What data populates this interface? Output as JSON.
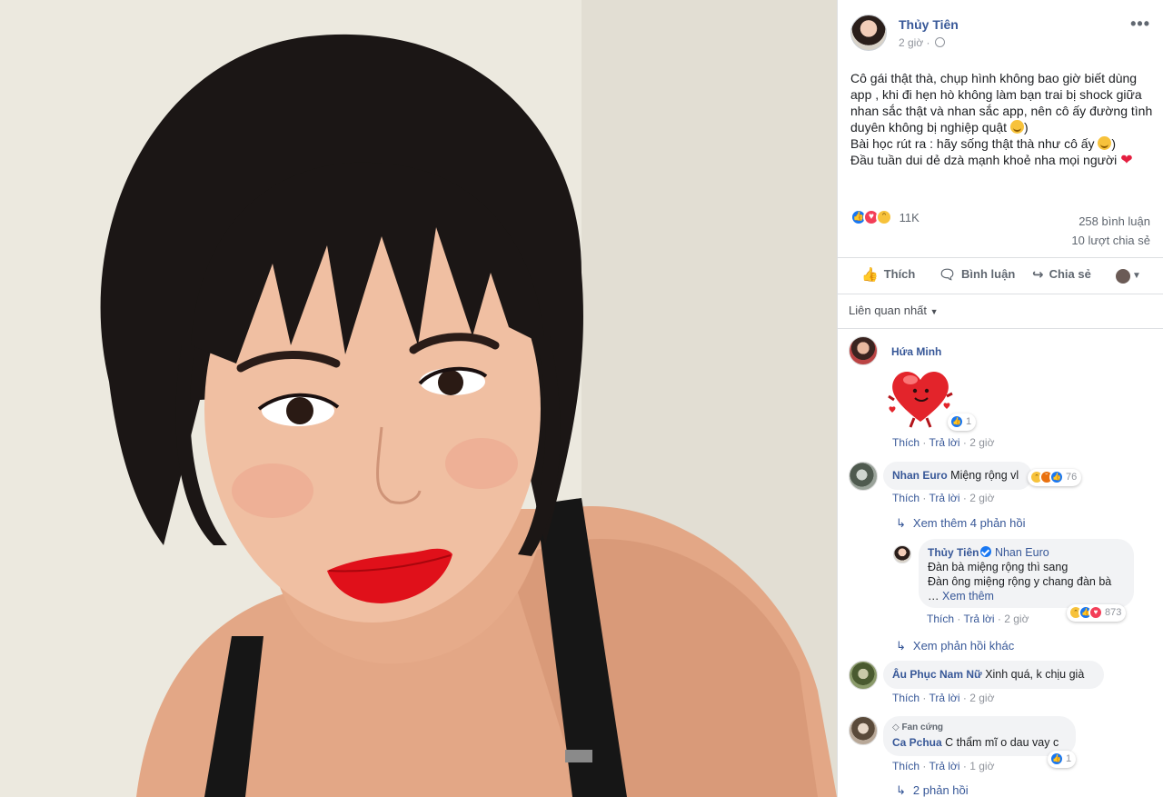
{
  "post": {
    "author": "Thủy Tiên",
    "time": "2 giờ",
    "privacy_icon": "globe-icon",
    "more_label": "•••",
    "text_lines": [
      "Cô gái thật thà, chụp hình không bao giờ biết dùng app , khi đi hẹn hò không làm bạn trai bị shock giữa nhan sắc thật và nhan sắc app, nên cô ấy đường tình duyên không bị nghiệp quật",
      "Bài học rút ra : hãy sống thật thà như cô ấy",
      "Đầu tuần dui dẻ dzà mạnh khoẻ nha mọi người"
    ],
    "line_suffix_1": ")",
    "line_suffix_2": ")",
    "reaction_icons": [
      "like-icon",
      "love-icon",
      "haha-icon"
    ],
    "reaction_count": "11K",
    "comments_count": "258 bình luận",
    "shares_count": "10 lượt chia sẻ"
  },
  "actions": {
    "like": "Thích",
    "comment": "Bình luận",
    "share": "Chia sẻ"
  },
  "filter": {
    "label": "Liên quan nhất"
  },
  "comments": [
    {
      "name": "Hứa Minh",
      "sticker": "heart-sticker",
      "reaction_count": "1",
      "links": [
        "Thích",
        "Trả lời"
      ],
      "time": "2 giờ"
    },
    {
      "name": "Nhan Euro",
      "text": "Miệng rộng vl",
      "reaction_count": "76",
      "links": [
        "Thích",
        "Trả lời"
      ],
      "time": "2 giờ",
      "see_replies": "Xem thêm 4 phản hồi",
      "reply": {
        "name": "Thủy Tiên",
        "mention": "Nhan Euro",
        "line1": "Đàn bà miệng rộng thì sang",
        "line2": "Đàn ông miệng rộng y chang đàn bà",
        "see_more_prefix": "…",
        "see_more": "Xem thêm",
        "reaction_count": "873",
        "links": [
          "Thích",
          "Trả lời"
        ],
        "time": "2 giờ"
      },
      "other_replies": "Xem phản hồi khác"
    },
    {
      "name": "Âu Phục Nam Nữ",
      "text": "Xinh quá, k chịu già",
      "links": [
        "Thích",
        "Trả lời"
      ],
      "time": "2 giờ"
    },
    {
      "badge": "Fan cứng",
      "name": "Ca Pchua",
      "text": "C thẩm mĩ o dau vay c",
      "reaction_count": "1",
      "links": [
        "Thích",
        "Trả lời"
      ],
      "time": "1 giờ",
      "replies": "2 phản hồi"
    }
  ],
  "colors": {
    "link": "#385898",
    "like": "#1877f2",
    "love": "#f33e58",
    "haha": "#f7c23b",
    "angry": "#e9710f",
    "lip": "#e0101a"
  }
}
